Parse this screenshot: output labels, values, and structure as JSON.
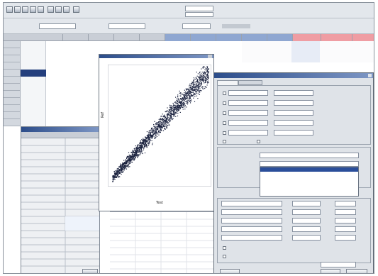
{
  "toolbar": {
    "icons": [
      "open-icon",
      "save-icon",
      "print-icon",
      "copy-icon",
      "paste-icon",
      "chart-icon",
      "table-icon",
      "filter-icon",
      "help-icon"
    ],
    "fields": [
      {
        "label": "",
        "value": ""
      },
      {
        "label": "",
        "value": ""
      },
      {
        "label": "",
        "value": ""
      },
      {
        "label": "",
        "value": ""
      }
    ]
  },
  "grid": {
    "columns": [
      "",
      "",
      "",
      "",
      "",
      "",
      "",
      "",
      "",
      "",
      "",
      "",
      ""
    ],
    "row_headers": [
      "",
      "",
      "",
      "",
      "",
      "",
      "",
      "",
      "",
      "",
      "",
      "",
      "",
      "",
      "",
      "",
      "",
      "",
      "",
      "",
      "",
      "",
      "",
      "",
      "",
      "",
      "",
      "",
      ""
    ],
    "left_values": [
      "",
      "",
      "",
      "",
      "",
      "",
      "",
      "",
      "",
      "",
      ""
    ]
  },
  "plot": {
    "xlabel": "Test",
    "ylabel": "Ref",
    "window_title": ""
  },
  "properties_panel": {
    "title": "",
    "headers": [
      "",
      ""
    ]
  },
  "dialog": {
    "title": "",
    "tabs": [
      "",
      ""
    ],
    "list_items": [
      "",
      "",
      "",
      "",
      "",
      "",
      "",
      "",
      ""
    ],
    "buttons": [
      "",
      "",
      ""
    ]
  },
  "colors": {
    "title_bar": "#2c4d8a",
    "highlight": "#2a4e9a",
    "grid_header": "#c9ced6",
    "scatter_points": "#1c2340"
  }
}
